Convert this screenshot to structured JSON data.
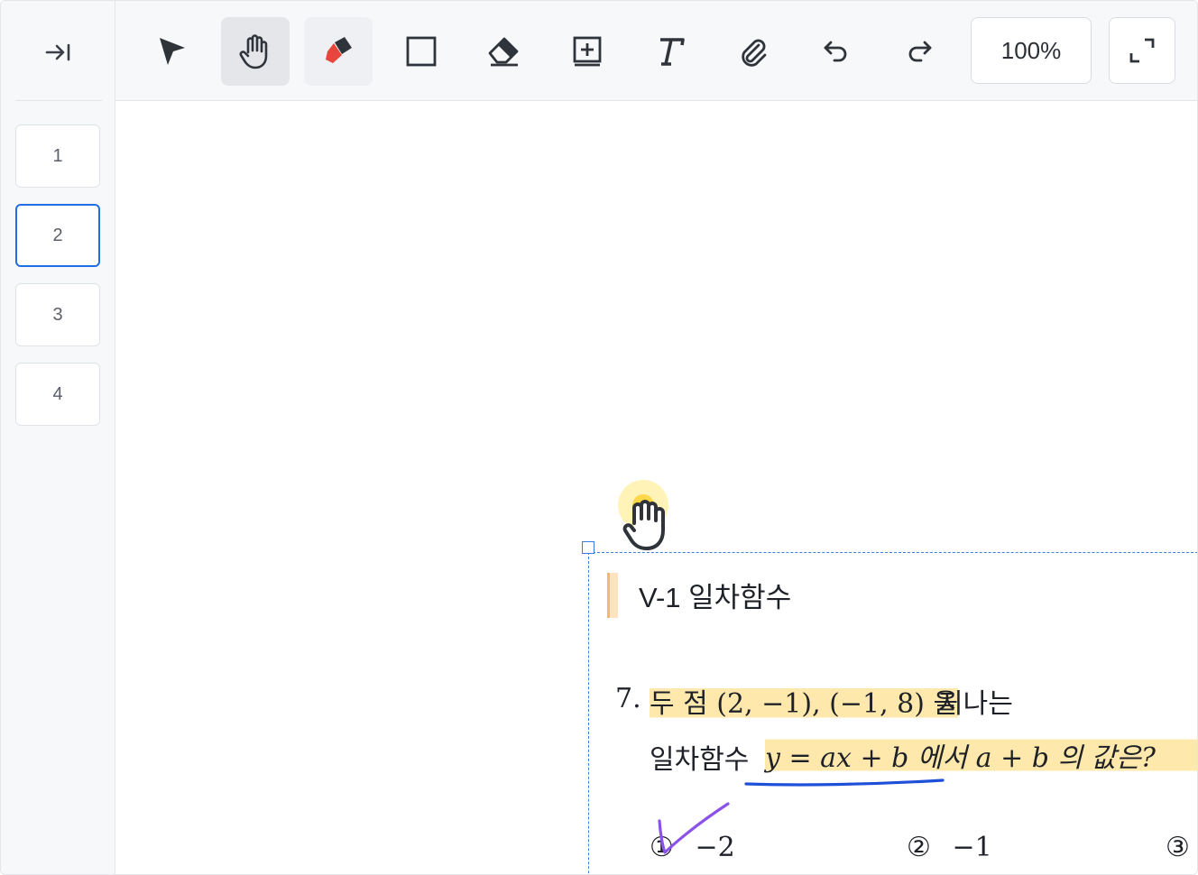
{
  "sidebar": {
    "collapse_icon": "collapse-right-icon",
    "pages": [
      {
        "label": "1",
        "active": false
      },
      {
        "label": "2",
        "active": true
      },
      {
        "label": "3",
        "active": false
      },
      {
        "label": "4",
        "active": false
      }
    ]
  },
  "toolbar": {
    "tools": [
      "select-arrow-icon",
      "hand-icon",
      "highlighter-icon",
      "rectangle-icon",
      "eraser-icon",
      "add-box-icon",
      "text-icon",
      "paperclip-icon",
      "undo-icon",
      "redo-icon"
    ],
    "active_tool": "hand-icon",
    "zoom": "100%",
    "fullscreen_icon": "fullscreen-icon"
  },
  "document": {
    "section_title": "V-1 일차함수",
    "question_number": "7.",
    "line1_highlighted": "두 점 (2, −1), (−1, 8) 을",
    "line1_rest": "지나는",
    "line2_prefix": "일차함수",
    "line2_main": "y = ax + b 에서  a + b 의 값은?",
    "options": [
      {
        "marker": "①",
        "value": "−2"
      },
      {
        "marker": "②",
        "value": "−1"
      },
      {
        "marker": "③",
        "value": ""
      }
    ]
  },
  "colors": {
    "accent": "#1f6ee6",
    "highlight": "#ffd666",
    "underline": "#1d4fd8",
    "check_mark": "#8a52e8"
  }
}
